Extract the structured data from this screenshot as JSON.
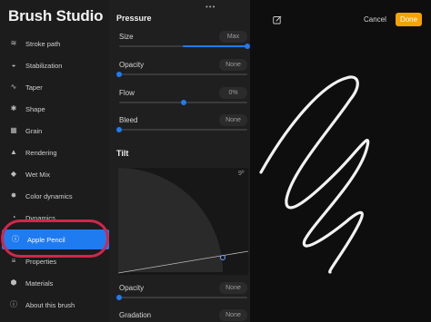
{
  "sidebar": {
    "title": "Brush Studio",
    "items": [
      {
        "label": "Stroke path",
        "icon": "stroke-path-icon",
        "glyph": "≋"
      },
      {
        "label": "Stabilization",
        "icon": "stabilization-icon",
        "glyph": "◒"
      },
      {
        "label": "Taper",
        "icon": "taper-icon",
        "glyph": "∿"
      },
      {
        "label": "Shape",
        "icon": "shape-icon",
        "glyph": "✱"
      },
      {
        "label": "Grain",
        "icon": "grain-icon",
        "glyph": "▦"
      },
      {
        "label": "Rendering",
        "icon": "rendering-icon",
        "glyph": "▲"
      },
      {
        "label": "Wet Mix",
        "icon": "wet-mix-icon",
        "glyph": "◆"
      },
      {
        "label": "Color dynamics",
        "icon": "color-dynamics-icon",
        "glyph": "✸"
      },
      {
        "label": "Dynamics",
        "icon": "dynamics-icon",
        "glyph": "◔"
      },
      {
        "label": "Apple Pencil",
        "icon": "info-icon",
        "glyph": "ⓘ"
      },
      {
        "label": "Properties",
        "icon": "properties-icon",
        "glyph": "≡"
      },
      {
        "label": "Materials",
        "icon": "materials-icon",
        "glyph": "⬢"
      },
      {
        "label": "About this brush",
        "icon": "about-icon",
        "glyph": "ⓘ"
      }
    ],
    "active_index": 9
  },
  "pressure": {
    "title": "Pressure",
    "rows": [
      {
        "label": "Size",
        "value": "Max",
        "level": 1.0,
        "fill": true
      },
      {
        "label": "Opacity",
        "value": "None",
        "level": 0.0,
        "fill": false
      },
      {
        "label": "Flow",
        "value": "0%",
        "level": 0.5,
        "fill": false
      },
      {
        "label": "Bleed",
        "value": "None",
        "level": 0.0,
        "fill": false
      }
    ]
  },
  "tilt": {
    "title": "Tilt",
    "angle": "9º",
    "rows": [
      {
        "label": "Opacity",
        "value": "None",
        "level": 0.0
      },
      {
        "label": "Gradation",
        "value": "None",
        "level": 0.0
      }
    ]
  },
  "toolbar": {
    "cancel_label": "Cancel",
    "done_label": "Done",
    "edit_icon": "pencil-edit-icon"
  },
  "colors": {
    "accent": "#1f7bf0",
    "done_button": "#f5a300",
    "highlight_ring": "#d4254b"
  }
}
